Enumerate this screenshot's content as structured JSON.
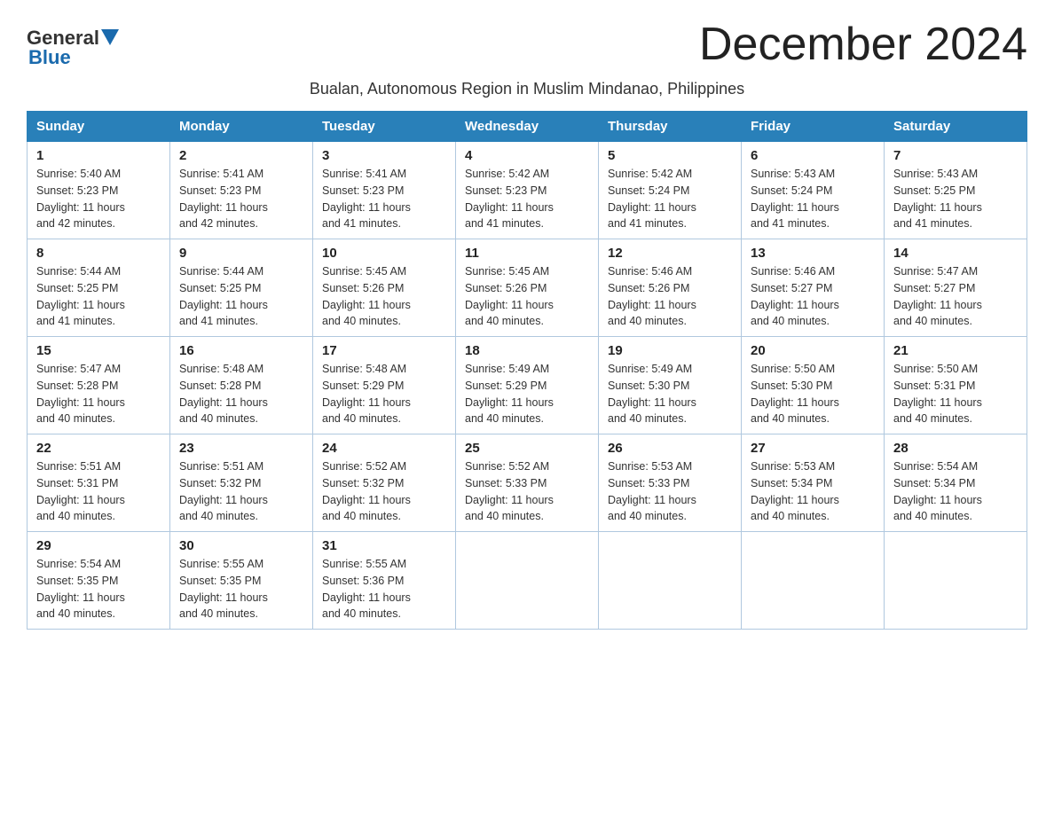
{
  "header": {
    "logo_general": "General",
    "logo_blue": "Blue",
    "month_title": "December 2024",
    "subtitle": "Bualan, Autonomous Region in Muslim Mindanao, Philippines"
  },
  "days_of_week": [
    "Sunday",
    "Monday",
    "Tuesday",
    "Wednesday",
    "Thursday",
    "Friday",
    "Saturday"
  ],
  "weeks": [
    [
      {
        "day": "1",
        "sunrise": "5:40 AM",
        "sunset": "5:23 PM",
        "daylight": "11 hours and 42 minutes."
      },
      {
        "day": "2",
        "sunrise": "5:41 AM",
        "sunset": "5:23 PM",
        "daylight": "11 hours and 42 minutes."
      },
      {
        "day": "3",
        "sunrise": "5:41 AM",
        "sunset": "5:23 PM",
        "daylight": "11 hours and 41 minutes."
      },
      {
        "day": "4",
        "sunrise": "5:42 AM",
        "sunset": "5:23 PM",
        "daylight": "11 hours and 41 minutes."
      },
      {
        "day": "5",
        "sunrise": "5:42 AM",
        "sunset": "5:24 PM",
        "daylight": "11 hours and 41 minutes."
      },
      {
        "day": "6",
        "sunrise": "5:43 AM",
        "sunset": "5:24 PM",
        "daylight": "11 hours and 41 minutes."
      },
      {
        "day": "7",
        "sunrise": "5:43 AM",
        "sunset": "5:25 PM",
        "daylight": "11 hours and 41 minutes."
      }
    ],
    [
      {
        "day": "8",
        "sunrise": "5:44 AM",
        "sunset": "5:25 PM",
        "daylight": "11 hours and 41 minutes."
      },
      {
        "day": "9",
        "sunrise": "5:44 AM",
        "sunset": "5:25 PM",
        "daylight": "11 hours and 41 minutes."
      },
      {
        "day": "10",
        "sunrise": "5:45 AM",
        "sunset": "5:26 PM",
        "daylight": "11 hours and 40 minutes."
      },
      {
        "day": "11",
        "sunrise": "5:45 AM",
        "sunset": "5:26 PM",
        "daylight": "11 hours and 40 minutes."
      },
      {
        "day": "12",
        "sunrise": "5:46 AM",
        "sunset": "5:26 PM",
        "daylight": "11 hours and 40 minutes."
      },
      {
        "day": "13",
        "sunrise": "5:46 AM",
        "sunset": "5:27 PM",
        "daylight": "11 hours and 40 minutes."
      },
      {
        "day": "14",
        "sunrise": "5:47 AM",
        "sunset": "5:27 PM",
        "daylight": "11 hours and 40 minutes."
      }
    ],
    [
      {
        "day": "15",
        "sunrise": "5:47 AM",
        "sunset": "5:28 PM",
        "daylight": "11 hours and 40 minutes."
      },
      {
        "day": "16",
        "sunrise": "5:48 AM",
        "sunset": "5:28 PM",
        "daylight": "11 hours and 40 minutes."
      },
      {
        "day": "17",
        "sunrise": "5:48 AM",
        "sunset": "5:29 PM",
        "daylight": "11 hours and 40 minutes."
      },
      {
        "day": "18",
        "sunrise": "5:49 AM",
        "sunset": "5:29 PM",
        "daylight": "11 hours and 40 minutes."
      },
      {
        "day": "19",
        "sunrise": "5:49 AM",
        "sunset": "5:30 PM",
        "daylight": "11 hours and 40 minutes."
      },
      {
        "day": "20",
        "sunrise": "5:50 AM",
        "sunset": "5:30 PM",
        "daylight": "11 hours and 40 minutes."
      },
      {
        "day": "21",
        "sunrise": "5:50 AM",
        "sunset": "5:31 PM",
        "daylight": "11 hours and 40 minutes."
      }
    ],
    [
      {
        "day": "22",
        "sunrise": "5:51 AM",
        "sunset": "5:31 PM",
        "daylight": "11 hours and 40 minutes."
      },
      {
        "day": "23",
        "sunrise": "5:51 AM",
        "sunset": "5:32 PM",
        "daylight": "11 hours and 40 minutes."
      },
      {
        "day": "24",
        "sunrise": "5:52 AM",
        "sunset": "5:32 PM",
        "daylight": "11 hours and 40 minutes."
      },
      {
        "day": "25",
        "sunrise": "5:52 AM",
        "sunset": "5:33 PM",
        "daylight": "11 hours and 40 minutes."
      },
      {
        "day": "26",
        "sunrise": "5:53 AM",
        "sunset": "5:33 PM",
        "daylight": "11 hours and 40 minutes."
      },
      {
        "day": "27",
        "sunrise": "5:53 AM",
        "sunset": "5:34 PM",
        "daylight": "11 hours and 40 minutes."
      },
      {
        "day": "28",
        "sunrise": "5:54 AM",
        "sunset": "5:34 PM",
        "daylight": "11 hours and 40 minutes."
      }
    ],
    [
      {
        "day": "29",
        "sunrise": "5:54 AM",
        "sunset": "5:35 PM",
        "daylight": "11 hours and 40 minutes."
      },
      {
        "day": "30",
        "sunrise": "5:55 AM",
        "sunset": "5:35 PM",
        "daylight": "11 hours and 40 minutes."
      },
      {
        "day": "31",
        "sunrise": "5:55 AM",
        "sunset": "5:36 PM",
        "daylight": "11 hours and 40 minutes."
      },
      null,
      null,
      null,
      null
    ]
  ],
  "labels": {
    "sunrise": "Sunrise:",
    "sunset": "Sunset:",
    "daylight": "Daylight:"
  }
}
